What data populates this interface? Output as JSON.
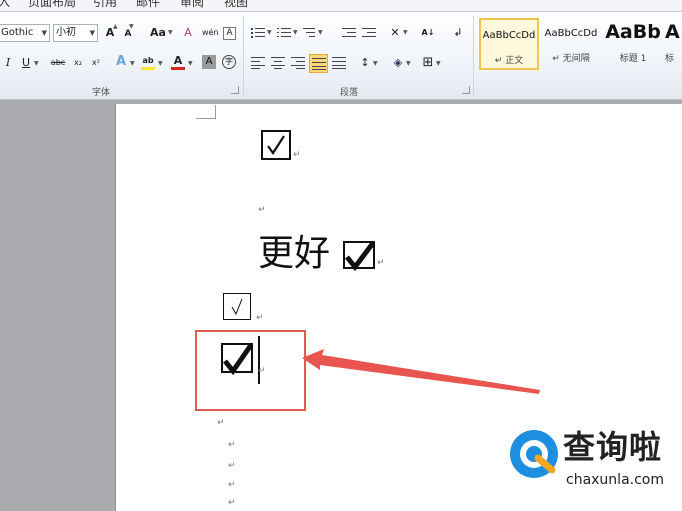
{
  "tabs": [
    "页面布局",
    "引用",
    "邮件",
    "审阅",
    "视图"
  ],
  "font_group": {
    "font_name": "Gothic",
    "font_size": "小初",
    "label": "字体",
    "buttons": {
      "grow": "A",
      "shrink": "A",
      "change_case": "Aa",
      "clear_format": "A",
      "phonetic": "wén",
      "border_char": "A",
      "italic": "I",
      "underline": "U",
      "strike": "abc",
      "subscript": "x₂",
      "superscript": "x²",
      "text_effect": "A",
      "highlight": "ab",
      "font_color": "A",
      "char_shading": "A",
      "enclose": "字"
    }
  },
  "paragraph_group": {
    "label": "段落"
  },
  "styles": [
    {
      "sample": "AaBbCcDd",
      "name": "↵ 正文"
    },
    {
      "sample": "AaBbCcDd",
      "name": "↵ 无间隔"
    },
    {
      "sample": "AaBb",
      "name": "标题 1"
    },
    {
      "sample": "A",
      "name": "标"
    }
  ],
  "document": {
    "text_line": "更好",
    "paragraph_mark": "↵"
  },
  "colors": {
    "highlight_border": "#e05a4f",
    "arrow": "#e8554e",
    "highlighter": "#f5e532",
    "font_color": "#d9261c"
  },
  "watermark": {
    "brand": "查询啦",
    "url": "chaxunla.com"
  }
}
